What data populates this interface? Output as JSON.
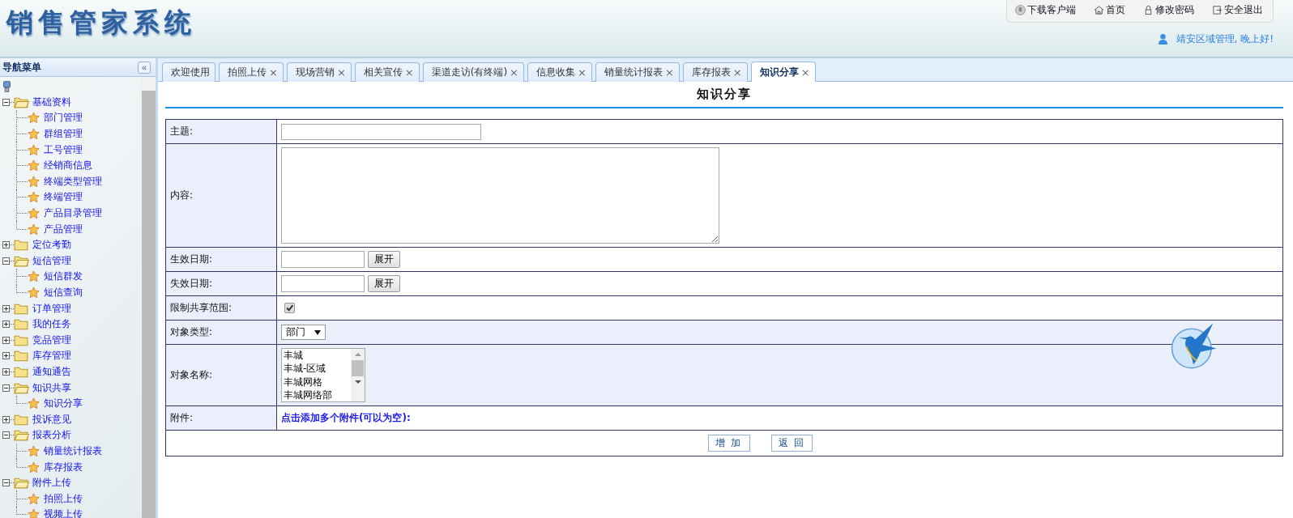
{
  "header": {
    "logo": "销售管家系统",
    "toolbar": [
      {
        "kind": "download",
        "label": "下载客户端"
      },
      {
        "kind": "home",
        "label": "首页"
      },
      {
        "kind": "lock",
        "label": "修改密码"
      },
      {
        "kind": "exit",
        "label": "安全退出"
      }
    ],
    "greeting": "靖安区域管理, 晚上好!"
  },
  "nav": {
    "title": "导航菜单",
    "collapse": "«",
    "items": [
      {
        "label": "基础资料",
        "expanded": true,
        "children": [
          {
            "label": "部门管理"
          },
          {
            "label": "群组管理"
          },
          {
            "label": "工号管理"
          },
          {
            "label": "经销商信息"
          },
          {
            "label": "终端类型管理"
          },
          {
            "label": "终端管理"
          },
          {
            "label": "产品目录管理"
          },
          {
            "label": "产品管理"
          }
        ]
      },
      {
        "label": "定位考勤",
        "expanded": false
      },
      {
        "label": "短信管理",
        "expanded": true,
        "children": [
          {
            "label": "短信群发"
          },
          {
            "label": "短信查询"
          }
        ]
      },
      {
        "label": "订单管理",
        "expanded": false
      },
      {
        "label": "我的任务",
        "expanded": false
      },
      {
        "label": "竞品管理",
        "expanded": false
      },
      {
        "label": "库存管理",
        "expanded": false
      },
      {
        "label": "通知通告",
        "expanded": false
      },
      {
        "label": "知识共享",
        "expanded": true,
        "children": [
          {
            "label": "知识分享"
          }
        ]
      },
      {
        "label": "投诉意见",
        "expanded": false
      },
      {
        "label": "报表分析",
        "expanded": true,
        "children": [
          {
            "label": "销量统计报表"
          },
          {
            "label": "库存报表"
          }
        ]
      },
      {
        "label": "附件上传",
        "expanded": true,
        "children": [
          {
            "label": "拍照上传"
          },
          {
            "label": "视频上传"
          }
        ]
      }
    ]
  },
  "tabs": [
    {
      "label": "欢迎使用",
      "closable": false,
      "selected": false
    },
    {
      "label": "拍照上传",
      "closable": true,
      "selected": false
    },
    {
      "label": "现场营销",
      "closable": true,
      "selected": false
    },
    {
      "label": "相关宣传",
      "closable": true,
      "selected": false
    },
    {
      "label": "渠道走访(有终端)",
      "closable": true,
      "selected": false
    },
    {
      "label": "信息收集",
      "closable": true,
      "selected": false
    },
    {
      "label": "销量统计报表",
      "closable": true,
      "selected": false
    },
    {
      "label": "库存报表",
      "closable": true,
      "selected": false
    },
    {
      "label": "知识分享",
      "closable": true,
      "selected": true
    }
  ],
  "close_glyph": "×",
  "form": {
    "title": "知识分享",
    "rows": [
      {
        "kind": "text",
        "label": "主题:",
        "shaded": false
      },
      {
        "kind": "textarea",
        "label": "内容:",
        "shaded": false
      },
      {
        "kind": "date",
        "label": "生效日期:",
        "button": "展开",
        "shaded": false
      },
      {
        "kind": "date",
        "label": "失效日期:",
        "button": "展开",
        "shaded": false
      },
      {
        "kind": "checkbox",
        "label": "限制共享范围:",
        "checked": true,
        "shaded": false
      },
      {
        "kind": "select",
        "label": "对象类型:",
        "value": "部门",
        "shaded": true
      },
      {
        "kind": "listbox",
        "label": "对象名称:",
        "options": [
          "丰城",
          "丰城-区域",
          "丰城网格",
          "丰城网络部"
        ],
        "shaded": true
      },
      {
        "kind": "link",
        "label": "附件:",
        "link": "点击添加多个附件(可以为空):",
        "shaded": false
      }
    ],
    "buttons": [
      "增 加",
      "返 回"
    ]
  }
}
